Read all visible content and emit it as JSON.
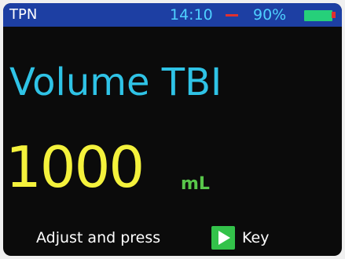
{
  "status_bar": {
    "mode": "TPN",
    "time": "14:10",
    "battery_percent": "90%",
    "battery_level": 0.9,
    "colors": {
      "bar": "#1d3fa3",
      "time": "#4fd0ff",
      "alert_dash": "#e03030",
      "battery": "#26d07a"
    }
  },
  "main": {
    "parameter_name": "Volume TBI",
    "value": "1000",
    "unit": "mL",
    "colors": {
      "parameter_name": "#2fc3e6",
      "value": "#f4f23c",
      "unit": "#58c64a",
      "background": "#0b0b0b"
    }
  },
  "prompt": {
    "before_key": "Adjust and press",
    "key_icon": "play-icon",
    "after_key": "Key",
    "key_color": "#33c24a"
  }
}
